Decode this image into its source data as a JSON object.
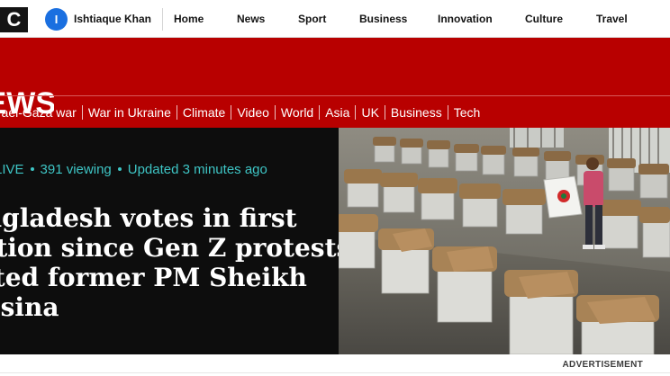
{
  "header": {
    "logo_letter": "C",
    "user": {
      "initial": "I",
      "name": "Ishtiaque Khan"
    },
    "nav": [
      "Home",
      "News",
      "Sport",
      "Business",
      "Innovation",
      "Culture",
      "Travel"
    ]
  },
  "banner": {
    "masthead": "NEWS",
    "subnav": [
      "Israel-Gaza war",
      "War in Ukraine",
      "Climate",
      "Video",
      "World",
      "Asia",
      "UK",
      "Business",
      "Tech"
    ]
  },
  "hero": {
    "live_prefix": "LIVE",
    "viewing": "391 viewing",
    "updated": "Updated 3 minutes ago",
    "headline_lines": [
      "Bangladesh votes in first",
      "election since Gen Z protests",
      "ousted former PM Sheikh",
      "Hasina"
    ]
  },
  "ad": {
    "label": "ADVERTISEMENT"
  },
  "colors": {
    "brand_red": "#b80000",
    "live_teal": "#3ec5c5",
    "avatar_blue": "#1a6fe0"
  }
}
